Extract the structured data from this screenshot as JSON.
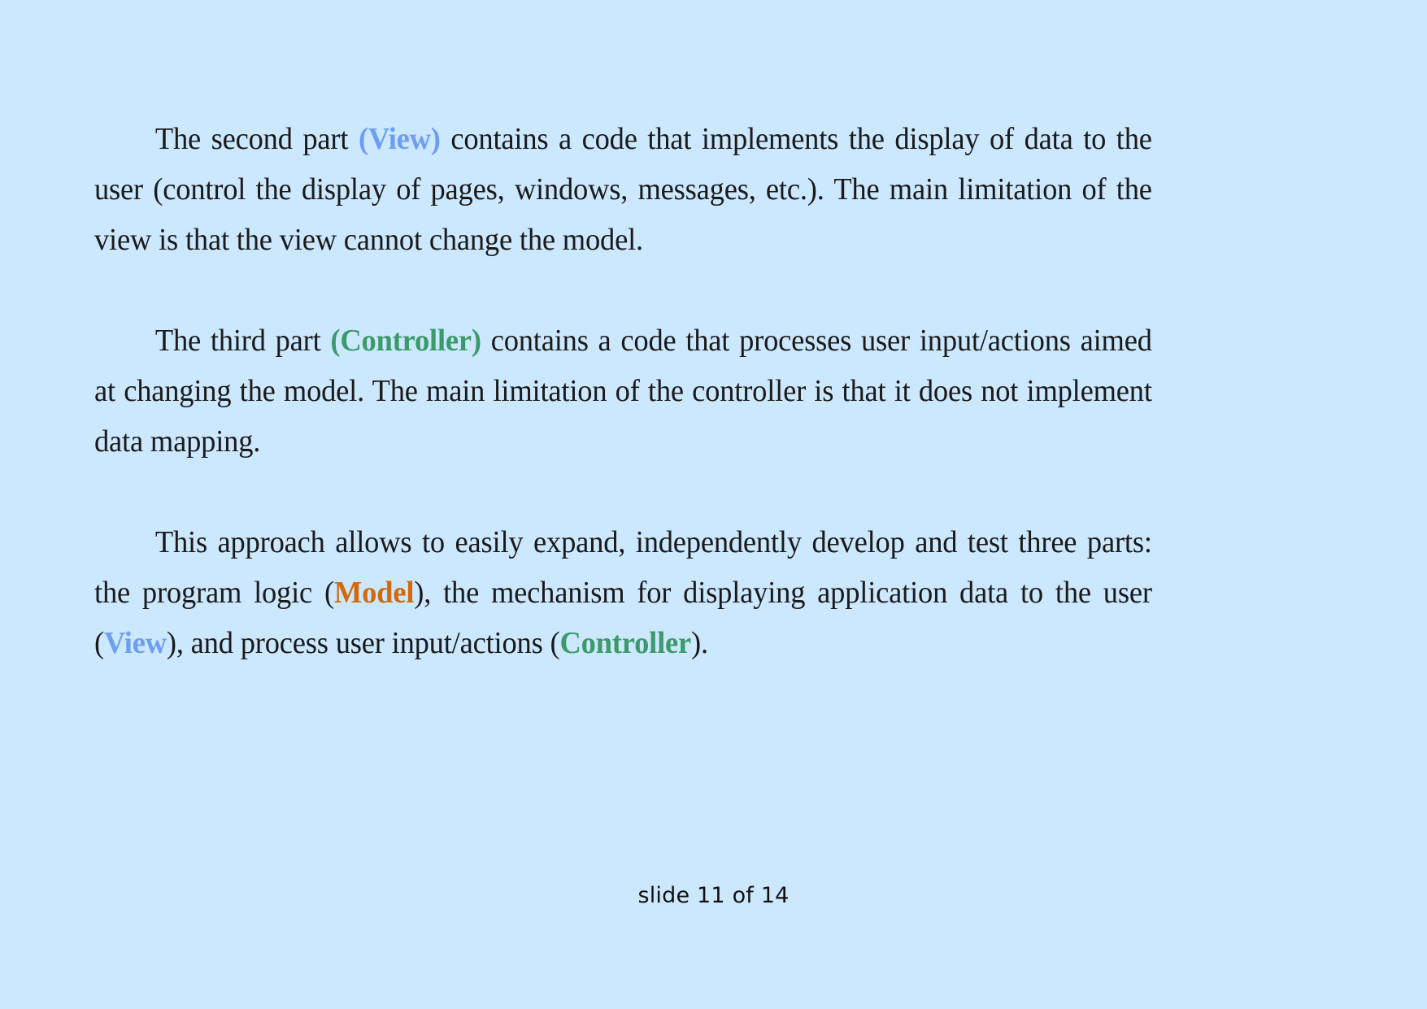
{
  "slide": {
    "background_color": "#cce8ff",
    "body_text_color": "#1a1a1a",
    "accent_colors": {
      "view": "#6e9ef0",
      "controller": "#3c9a6a",
      "model": "#d2690a"
    },
    "paragraphs": [
      {
        "id": "view-paragraph",
        "runs": [
          {
            "text": "The second part ",
            "style": "normal"
          },
          {
            "text": "(View)",
            "style": "keyword-view"
          },
          {
            "text": " contains a code that implements the display of data to the user (control the display of pages, windows, messages, etc.). The main limitation of the view is that the view cannot change the model.",
            "style": "normal"
          }
        ]
      },
      {
        "id": "controller-paragraph",
        "runs": [
          {
            "text": "The third part ",
            "style": "normal"
          },
          {
            "text": "(Controller)",
            "style": "keyword-controller"
          },
          {
            "text": " contains a code that processes user input/actions aimed at changing the model. The main limitation of the controller is that it does not implement data mapping.",
            "style": "normal"
          }
        ]
      },
      {
        "id": "summary-paragraph",
        "runs": [
          {
            "text": "This approach allows to easily expand, independently develop and test three parts: the program logic (",
            "style": "normal"
          },
          {
            "text": "Model",
            "style": "keyword-model"
          },
          {
            "text": "), the mechanism for displaying application data to the user (",
            "style": "normal"
          },
          {
            "text": "View",
            "style": "keyword-view"
          },
          {
            "text": "), and process user input/actions (",
            "style": "normal"
          },
          {
            "text": "Controller",
            "style": "keyword-controller"
          },
          {
            "text": ").",
            "style": "normal"
          }
        ]
      }
    ],
    "footer": {
      "text": "slide 11 of 14",
      "current_slide": 11,
      "total_slides": 14
    }
  }
}
